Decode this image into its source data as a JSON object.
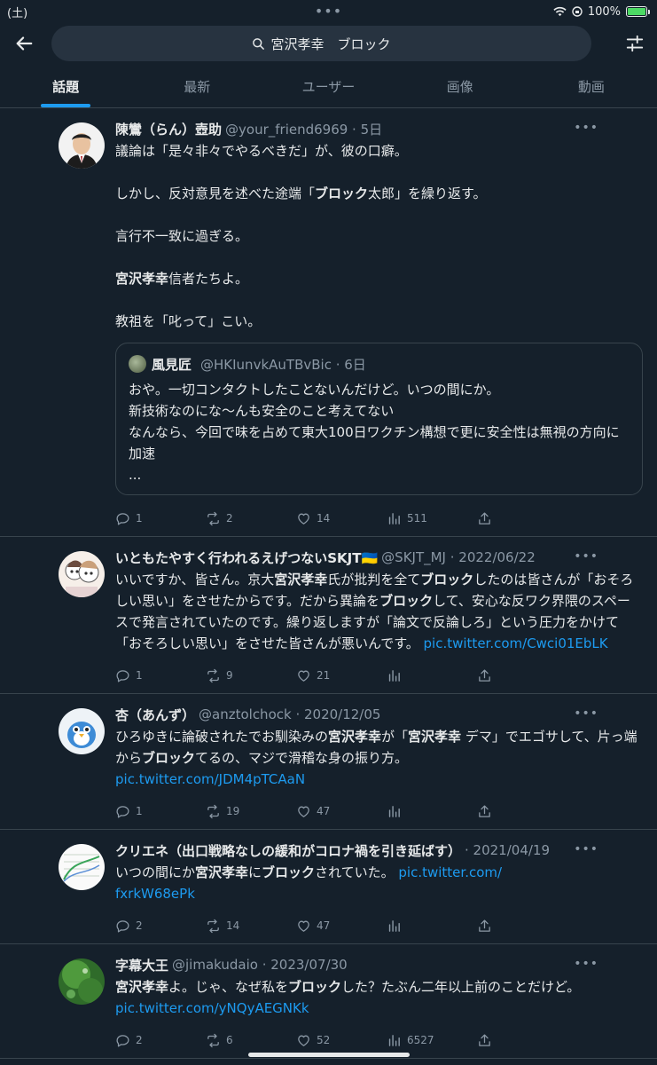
{
  "status": {
    "day": "(土)",
    "battery_pct": "100%",
    "battery_level": 1.0
  },
  "search": {
    "query": "宮沢孝幸　ブロック"
  },
  "tabs": [
    {
      "label": "話題",
      "active": true
    },
    {
      "label": "最新"
    },
    {
      "label": "ユーザー"
    },
    {
      "label": "画像"
    },
    {
      "label": "動画"
    }
  ],
  "tweets": [
    {
      "name": "陳鸞（らん）壺助",
      "handle": "@your_friend6969 · 5日",
      "avatar": "avatar-man-suit",
      "text_html": "議論は「是々非々でやるべきだ」が、彼の口癖。\n\nしかし、反対意見を述べた途端「<b>ブロック</b>太郎」を繰り返す。\n\n言行不一致に過ぎる。\n\n<b>宮沢孝幸</b>信者たちよ。\n\n教祖を「叱って」こい。",
      "quote": {
        "name": "風見匠",
        "handle": "@HKIunvkAuTBvBic · 6日",
        "text": "おや。一切コンタクトしたことないんだけど。いつの間にか。\n新技術なのにな〜んも安全のこと考えてない\nなんなら、今回で味を占めて東大100日ワクチン構想で更に安全性は無視の方向に加速\n..."
      },
      "replies": "1",
      "retweets": "2",
      "likes": "14",
      "views": "511"
    },
    {
      "name": "いともたやすく行われるえげつないSKJT🇺🇦",
      "handle": "@SKJT_MJ · 2022/06/22",
      "avatar": "avatar-manga",
      "text_html": "いいですか、皆さん。京大<b>宮沢孝幸</b>氏が批判を全て<b>ブロック</b>したのは皆さんが「おそろしい思い」をさせたからです。だから異論を<b>ブロック</b>して、安心な反ワク界隈のスペースで発言されていたのです。繰り返しますが「論文で反論しろ」という圧力をかけて「おそろしい思い」をさせた皆さんが悪いんです。 <span class=\"link\">pic.twitter.com/Cwci01EbLK</span>",
      "replies": "1",
      "retweets": "9",
      "likes": "21",
      "views": ""
    },
    {
      "name": "杏（あんず）",
      "handle": "@anztolchock · 2020/12/05",
      "avatar": "avatar-bird",
      "text_html": "ひろゆきに論破されたでお馴染みの<b>宮沢孝幸</b>が「<b>宮沢孝幸</b> デマ」でエゴサして、片っ端から<b>ブロック</b>てるの、マジで滑稽な身の振り方。\n<span class=\"link\">pic.twitter.com/JDM4pTCAaN</span>",
      "replies": "1",
      "retweets": "19",
      "likes": "47",
      "views": ""
    },
    {
      "name": "クリエネ（出口戦略なしの緩和がコロナ禍を引き延ばす）",
      "handle": "· 2021/04/19",
      "avatar": "avatar-chart",
      "text_html": "いつの間にか<b>宮沢孝幸</b>に<b>ブロック</b>されていた。 <span class=\"link\">pic.twitter.com/\nfxrkW68ePk</span>",
      "replies": "2",
      "retweets": "14",
      "likes": "47",
      "views": ""
    },
    {
      "name": "字幕大王",
      "handle": "@jimakudaio · 2023/07/30",
      "avatar": "avatar-leaf",
      "text_html": "<b>宮沢孝幸</b>よ。じゃ、なぜ私を<b>ブロック</b>した？たぶん二年以上前のことだけど。 <span class=\"link\">pic.twitter.com/yNQyAEGNKk</span>",
      "replies": "2",
      "retweets": "6",
      "likes": "52",
      "views": "6527"
    }
  ]
}
